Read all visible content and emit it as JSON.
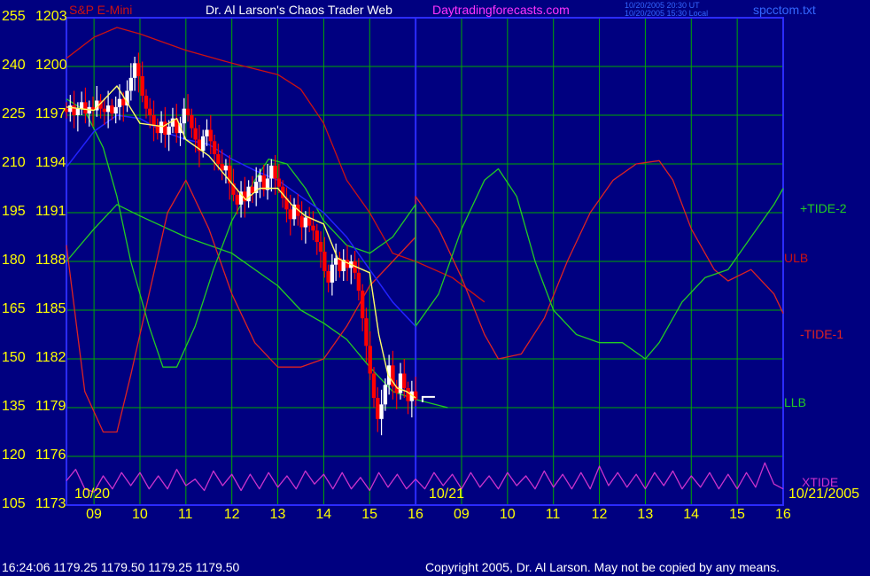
{
  "header": {
    "instrument": "S&P E-Mini",
    "title": "Dr. Al Larson's Chaos Trader Web",
    "site": "Daytradingforecasts.com",
    "timestamp_ut": "10/20/2005 20:30 UT",
    "timestamp_local": "10/20/2005 15:30 Local",
    "filename": "spcctom.txt"
  },
  "footer": {
    "quote": "16:24:06  1179.25 1179.50 1179.25 1179.50",
    "copyright": "Copyright 2005, Dr. Al Larson. May not be copied by any means."
  },
  "colors": {
    "background": "#000080",
    "grid": "#00aa00",
    "frame": "#2b2bff",
    "candle_down": "#ff0000",
    "candle_up": "#ffffff",
    "ulb": "#cc1111",
    "llb": "#22cc22",
    "tide1": "#dd2222",
    "tide2": "#22cc22",
    "xtide": "#cc33cc",
    "smooth": "#ffff66",
    "average": "#2222ff",
    "label_yellow": "#ffff00"
  },
  "chart_data": {
    "type": "line",
    "y_left_labels": [
      "255",
      "240",
      "225",
      "210",
      "195",
      "180",
      "165",
      "150",
      "135",
      "120",
      "105"
    ],
    "y_price_labels": [
      "1203",
      "1200",
      "1197",
      "1194",
      "1191",
      "1188",
      "1185",
      "1182",
      "1179",
      "1176",
      "1173"
    ],
    "price_range": [
      1173,
      1203
    ],
    "x_hour_labels": [
      "09",
      "10",
      "11",
      "12",
      "13",
      "14",
      "15",
      "16",
      "09",
      "10",
      "11",
      "12",
      "13",
      "14",
      "15",
      "16"
    ],
    "date_labels": [
      "10/20",
      "10/21",
      "10/21/2005"
    ],
    "series_labels": [
      "+TIDE-2",
      "ULB",
      "-TIDE-1",
      "LLB",
      "XTIDE"
    ],
    "last_price": 1179.5,
    "lines": {
      "ulb": [
        [
          8.4,
          1200.5
        ],
        [
          9.0,
          1201.8
        ],
        [
          9.5,
          1202.4
        ],
        [
          10.0,
          1202.0
        ],
        [
          11.0,
          1201.0
        ],
        [
          12.0,
          1200.2
        ],
        [
          13.0,
          1199.5
        ],
        [
          13.5,
          1198.6
        ],
        [
          14.0,
          1196.5
        ],
        [
          14.5,
          1193.0
        ],
        [
          15.0,
          1191.0
        ],
        [
          15.5,
          1188.5
        ],
        [
          16.0,
          1188.0
        ],
        [
          16.8,
          1187.0
        ],
        [
          17.5,
          1185.5
        ]
      ],
      "llb": [
        [
          8.4,
          1188.0
        ],
        [
          9.0,
          1190.0
        ],
        [
          9.5,
          1191.5
        ],
        [
          10.0,
          1190.8
        ],
        [
          11.0,
          1189.5
        ],
        [
          12.0,
          1188.5
        ],
        [
          13.0,
          1186.5
        ],
        [
          13.5,
          1185.0
        ],
        [
          14.0,
          1184.2
        ],
        [
          14.5,
          1183.2
        ],
        [
          15.0,
          1181.5
        ],
        [
          15.5,
          1180.0
        ],
        [
          16.0,
          1179.5
        ],
        [
          16.7,
          1179.0
        ]
      ],
      "tide1": [
        [
          8.4,
          1189.0
        ],
        [
          8.8,
          1180.0
        ],
        [
          9.2,
          1177.5
        ],
        [
          9.5,
          1177.5
        ],
        [
          9.8,
          1181.0
        ],
        [
          10.2,
          1186.0
        ],
        [
          10.6,
          1191.0
        ],
        [
          11.0,
          1193.0
        ],
        [
          11.5,
          1190.0
        ],
        [
          12.0,
          1186.0
        ],
        [
          12.5,
          1183.0
        ],
        [
          13.0,
          1181.5
        ],
        [
          13.5,
          1181.5
        ],
        [
          14.0,
          1182.0
        ],
        [
          14.5,
          1184.0
        ],
        [
          15.0,
          1186.5
        ],
        [
          15.5,
          1188.0
        ],
        [
          16.0,
          1189.5
        ],
        [
          16.0,
          1192.0
        ],
        [
          16.5,
          1190.0
        ],
        [
          17.0,
          1187.0
        ],
        [
          17.5,
          1183.5
        ],
        [
          17.8,
          1182.0
        ],
        [
          18.3,
          1182.3
        ],
        [
          18.8,
          1184.5
        ],
        [
          19.3,
          1188.0
        ],
        [
          19.8,
          1191.0
        ],
        [
          20.3,
          1193.0
        ],
        [
          20.8,
          1194.0
        ],
        [
          21.3,
          1194.2
        ],
        [
          21.6,
          1193.0
        ],
        [
          22.0,
          1190.0
        ],
        [
          22.5,
          1187.5
        ],
        [
          22.8,
          1186.8
        ],
        [
          23.3,
          1187.5
        ],
        [
          23.8,
          1186.0
        ],
        [
          24.0,
          1184.8
        ]
      ],
      "tide2": [
        [
          8.4,
          1198.0
        ],
        [
          8.8,
          1197.3
        ],
        [
          9.2,
          1195.0
        ],
        [
          9.5,
          1192.0
        ],
        [
          9.8,
          1188.0
        ],
        [
          10.2,
          1184.0
        ],
        [
          10.5,
          1181.5
        ],
        [
          10.8,
          1181.5
        ],
        [
          11.2,
          1184.0
        ],
        [
          11.6,
          1187.5
        ],
        [
          12.0,
          1190.5
        ],
        [
          12.5,
          1193.0
        ],
        [
          12.8,
          1194.3
        ],
        [
          13.2,
          1194.0
        ],
        [
          13.6,
          1192.5
        ],
        [
          14.0,
          1190.5
        ],
        [
          14.5,
          1189.0
        ],
        [
          15.0,
          1188.5
        ],
        [
          15.5,
          1189.5
        ],
        [
          16.0,
          1191.5
        ],
        [
          16.0,
          1184.0
        ],
        [
          16.5,
          1186.0
        ],
        [
          17.0,
          1190.0
        ],
        [
          17.5,
          1193.0
        ],
        [
          17.8,
          1193.7
        ],
        [
          18.2,
          1192.0
        ],
        [
          18.6,
          1188.0
        ],
        [
          19.0,
          1185.0
        ],
        [
          19.5,
          1183.5
        ],
        [
          20.0,
          1183.0
        ],
        [
          20.5,
          1183.0
        ],
        [
          21.0,
          1182.0
        ],
        [
          21.3,
          1183.0
        ],
        [
          21.8,
          1185.5
        ],
        [
          22.3,
          1187.0
        ],
        [
          22.8,
          1187.5
        ],
        [
          23.3,
          1189.5
        ],
        [
          23.8,
          1191.5
        ],
        [
          24.0,
          1192.5
        ]
      ],
      "xtide": [
        [
          8.4,
          1174.5
        ],
        [
          8.6,
          1175.2
        ],
        [
          8.8,
          1174.0
        ],
        [
          9.0,
          1173.8
        ],
        [
          9.2,
          1174.8
        ],
        [
          9.4,
          1174.0
        ],
        [
          9.6,
          1175.0
        ],
        [
          9.8,
          1174.2
        ],
        [
          10.0,
          1175.0
        ],
        [
          10.2,
          1174.0
        ],
        [
          10.4,
          1174.8
        ],
        [
          10.6,
          1174.0
        ],
        [
          10.8,
          1175.2
        ],
        [
          11.0,
          1174.2
        ],
        [
          11.2,
          1174.6
        ],
        [
          11.4,
          1173.9
        ],
        [
          11.6,
          1175.1
        ],
        [
          11.8,
          1174.2
        ],
        [
          12.0,
          1174.9
        ],
        [
          12.2,
          1173.9
        ],
        [
          12.4,
          1174.9
        ],
        [
          12.6,
          1174.0
        ],
        [
          12.8,
          1175.0
        ],
        [
          13.0,
          1174.1
        ],
        [
          13.2,
          1174.8
        ],
        [
          13.4,
          1174.0
        ],
        [
          13.6,
          1175.1
        ],
        [
          13.8,
          1174.3
        ],
        [
          14.0,
          1174.9
        ],
        [
          14.2,
          1174.0
        ],
        [
          14.4,
          1175.0
        ],
        [
          14.6,
          1174.0
        ],
        [
          14.8,
          1174.7
        ],
        [
          15.0,
          1173.9
        ],
        [
          15.2,
          1175.0
        ],
        [
          15.4,
          1174.1
        ],
        [
          15.6,
          1174.9
        ],
        [
          15.8,
          1174.0
        ],
        [
          16.0,
          1174.6
        ],
        [
          16.2,
          1174.0
        ],
        [
          16.4,
          1175.0
        ],
        [
          16.6,
          1174.2
        ],
        [
          16.8,
          1174.9
        ],
        [
          17.0,
          1174.0
        ],
        [
          17.2,
          1175.0
        ],
        [
          17.4,
          1174.1
        ],
        [
          17.6,
          1174.8
        ],
        [
          17.8,
          1174.0
        ],
        [
          18.0,
          1175.0
        ],
        [
          18.2,
          1174.2
        ],
        [
          18.4,
          1174.8
        ],
        [
          18.6,
          1174.0
        ],
        [
          18.8,
          1175.1
        ],
        [
          19.0,
          1174.1
        ],
        [
          19.2,
          1174.9
        ],
        [
          19.4,
          1174.0
        ],
        [
          19.6,
          1175.0
        ],
        [
          19.8,
          1174.0
        ],
        [
          20.0,
          1175.4
        ],
        [
          20.2,
          1174.2
        ],
        [
          20.4,
          1175.0
        ],
        [
          20.6,
          1174.1
        ],
        [
          20.8,
          1174.9
        ],
        [
          21.0,
          1174.0
        ],
        [
          21.2,
          1175.0
        ],
        [
          21.4,
          1174.2
        ],
        [
          21.6,
          1175.1
        ],
        [
          21.8,
          1174.0
        ],
        [
          22.0,
          1174.8
        ],
        [
          22.2,
          1174.1
        ],
        [
          22.4,
          1175.0
        ],
        [
          22.6,
          1174.0
        ],
        [
          22.8,
          1174.9
        ],
        [
          23.0,
          1174.0
        ],
        [
          23.2,
          1175.0
        ],
        [
          23.4,
          1174.1
        ],
        [
          23.6,
          1175.6
        ],
        [
          23.8,
          1174.3
        ],
        [
          24.0,
          1174.0
        ]
      ],
      "smooth": [
        [
          8.4,
          1197.5
        ],
        [
          9.0,
          1197.3
        ],
        [
          9.5,
          1198.8
        ],
        [
          10.0,
          1196.5
        ],
        [
          10.5,
          1196.3
        ],
        [
          10.8,
          1196.8
        ],
        [
          11.0,
          1195.5
        ],
        [
          11.5,
          1194.5
        ],
        [
          12.0,
          1192.8
        ],
        [
          12.3,
          1191.8
        ],
        [
          12.6,
          1192.5
        ],
        [
          13.0,
          1192.5
        ],
        [
          13.3,
          1191.5
        ],
        [
          13.6,
          1190.8
        ],
        [
          14.0,
          1190.3
        ],
        [
          14.3,
          1188.2
        ],
        [
          14.6,
          1187.8
        ],
        [
          15.0,
          1187.3
        ],
        [
          15.2,
          1183.5
        ],
        [
          15.4,
          1181.0
        ],
        [
          15.6,
          1180.2
        ],
        [
          15.8,
          1180.0
        ],
        [
          16.0,
          1179.6
        ]
      ],
      "average": [
        [
          8.4,
          1193.8
        ],
        [
          9.0,
          1196.0
        ],
        [
          9.5,
          1197.0
        ],
        [
          10.0,
          1196.8
        ],
        [
          10.5,
          1196.0
        ],
        [
          11.0,
          1195.5
        ],
        [
          11.5,
          1195.2
        ],
        [
          12.0,
          1194.3
        ],
        [
          12.5,
          1193.6
        ],
        [
          13.0,
          1193.0
        ],
        [
          13.5,
          1192.0
        ],
        [
          14.0,
          1191.0
        ],
        [
          14.5,
          1189.5
        ],
        [
          15.0,
          1187.5
        ],
        [
          15.5,
          1185.5
        ],
        [
          16.0,
          1184.0
        ]
      ]
    },
    "candle_closes": [
      1197.2,
      1197.6,
      1197.0,
      1197.4,
      1197.8,
      1197.1,
      1197.5,
      1197.3,
      1197.9,
      1197.4,
      1197.2,
      1197.6,
      1197.1,
      1197.5,
      1198.0,
      1197.6,
      1198.5,
      1199.3,
      1200.2,
      1199.4,
      1198.2,
      1197.4,
      1197.0,
      1196.4,
      1195.9,
      1196.6,
      1195.8,
      1196.3,
      1196.8,
      1195.9,
      1196.5,
      1197.4,
      1197.0,
      1196.2,
      1195.5,
      1194.8,
      1195.7,
      1196.1,
      1195.4,
      1194.6,
      1194.0,
      1193.6,
      1193.9,
      1192.8,
      1192.1,
      1191.5,
      1192.3,
      1191.7,
      1192.6,
      1192.2,
      1192.9,
      1193.3,
      1192.4,
      1193.1,
      1193.9,
      1193.1,
      1192.6,
      1191.9,
      1191.2,
      1190.6,
      1191.5,
      1190.8,
      1190.1,
      1190.7,
      1190.2,
      1189.9,
      1189.2,
      1188.6,
      1187.4,
      1186.7,
      1187.8,
      1188.2,
      1187.4,
      1188.1,
      1187.6,
      1188.0,
      1187.3,
      1186.2,
      1184.5,
      1182.8,
      1181.1,
      1179.6,
      1178.3,
      1179.2,
      1180.4,
      1181.6,
      1180.3,
      1179.9,
      1181.1,
      1180.2,
      1179.4,
      1180.0,
      1179.5
    ],
    "candle_start_hour": 8.4,
    "candle_end_hour": 16.0
  }
}
